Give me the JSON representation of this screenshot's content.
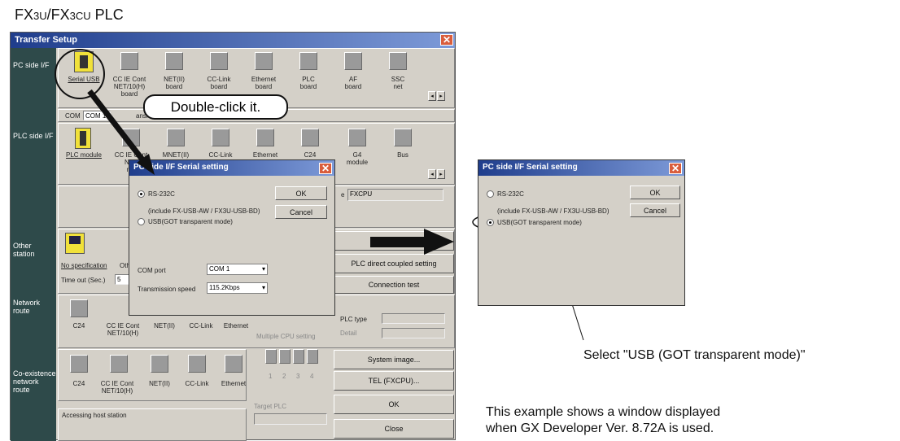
{
  "heading": {
    "fx": "FX",
    "fx_small": "3U",
    "sep": "/FX",
    "cu_small": "3CU",
    "plc": " PLC"
  },
  "transfer": {
    "title": "Transfer Setup",
    "sidebar": [
      "PC side I/F",
      "PLC side I/F",
      "Other station",
      "Network route",
      "Co-existence network route"
    ],
    "pc_if_items": [
      {
        "label": "Serial USB",
        "sub": ""
      },
      {
        "label": "CC IE Cont",
        "sub": "NET/10(H) board"
      },
      {
        "label": "NET(II)",
        "sub": "board"
      },
      {
        "label": "CC-Link",
        "sub": "board"
      },
      {
        "label": "Ethernet",
        "sub": "board"
      },
      {
        "label": "PLC",
        "sub": "board"
      },
      {
        "label": "AF",
        "sub": "board"
      },
      {
        "label": "SSC",
        "sub": "net"
      }
    ],
    "com_label": "COM",
    "com_value": "COM 1",
    "com_extra": "ansmissi",
    "plc_if_items": [
      {
        "label": "PLC module",
        "sub": ""
      },
      {
        "label": "CC IE Cont",
        "sub": "NET"
      },
      {
        "label": "MNET(II)",
        "sub": ""
      },
      {
        "label": "CC-Link",
        "sub": ""
      },
      {
        "label": "Ethernet",
        "sub": ""
      },
      {
        "label": "C24",
        "sub": ""
      },
      {
        "label": "G4",
        "sub": "module"
      },
      {
        "label": "Bus",
        "sub": ""
      }
    ],
    "plc_if_more": "mo",
    "cpu_label": "e",
    "cpu_value": "FXCPU",
    "other_link": "No specification",
    "other_extra": "Oth",
    "timeout_label": "Time out (Sec.)",
    "timeout_value": "5",
    "network_items": [
      "C24",
      "CC IE Cont NET/10(H)",
      "NET(II)",
      "CC-Link",
      "Ethernet"
    ],
    "coexist_items": [
      "C24",
      "CC IE Cont NET/10(H)",
      "NET(II)",
      "CC-Link",
      "Ethernet"
    ],
    "btn_connection": "Conn",
    "btn_direct": "PLC direct coupled setting",
    "btn_test": "Connection test",
    "plc_type_label": "PLC type",
    "detail_label": "Detail",
    "multi_cpu_label": "Multiple CPU setting",
    "cpu_nums": [
      "1",
      "2",
      "3",
      "4"
    ],
    "target_plc": "Target PLC",
    "btn_system": "System  image...",
    "btn_tel": "TEL (FXCPU)...",
    "btn_ok": "OK",
    "btn_close": "Close",
    "status": "Accessing host station"
  },
  "callout": "Double-click it.",
  "serial_dialog": {
    "title": "PC side I/F  Serial setting",
    "rs232": "RS-232C",
    "include": "(include FX-USB-AW / FX3U-USB-BD)",
    "usb": "USB(GOT transparent mode)",
    "ok": "OK",
    "cancel": "Cancel",
    "com_port_label": "COM port",
    "com_port_value": "COM 1",
    "speed_label": "Transmission speed",
    "speed_value": "115.2Kbps",
    "rs232_selected": true
  },
  "serial_dialog_right": {
    "title": "PC side I/F  Serial setting",
    "rs232": "RS-232C",
    "include": "(include FX-USB-AW / FX3U-USB-BD)",
    "usb": "USB(GOT transparent mode)",
    "ok": "OK",
    "cancel": "Cancel",
    "usb_selected": true
  },
  "select_note": "Select \"USB (GOT transparent mode)\"",
  "version_note_1": "This example shows a window displayed",
  "version_note_2": "when GX Developer Ver. 8.72A is used."
}
